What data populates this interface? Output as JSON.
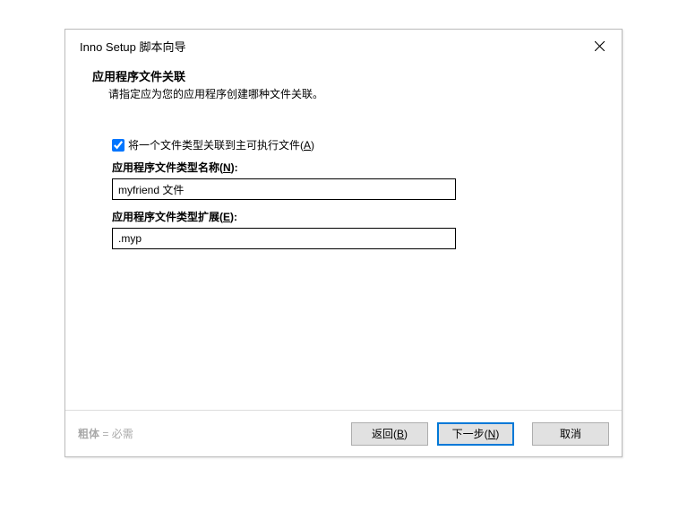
{
  "titlebar": {
    "title": "Inno Setup 脚本向导"
  },
  "header": {
    "title": "应用程序文件关联",
    "subtitle": "请指定应为您的应用程序创建哪种文件关联。"
  },
  "form": {
    "checkbox_label": "将一个文件类型关联到主可执行文件(",
    "checkbox_mnemonic": "A",
    "checkbox_suffix": ")",
    "checkbox_checked": true,
    "type_name_label": "应用程序文件类型名称(",
    "type_name_mnemonic": "N",
    "type_name_suffix": "):",
    "type_name_value": "myfriend 文件",
    "type_ext_label": "应用程序文件类型扩展(",
    "type_ext_mnemonic": "E",
    "type_ext_suffix": "):",
    "type_ext_value": ".myp"
  },
  "footer": {
    "bold_text": "粗体",
    "note_rest": " = 必需",
    "back_label": "返回(",
    "back_mnemonic": "B",
    "back_suffix": ")",
    "next_label": "下一步(",
    "next_mnemonic": "N",
    "next_suffix": ")",
    "cancel_label": "取消"
  }
}
